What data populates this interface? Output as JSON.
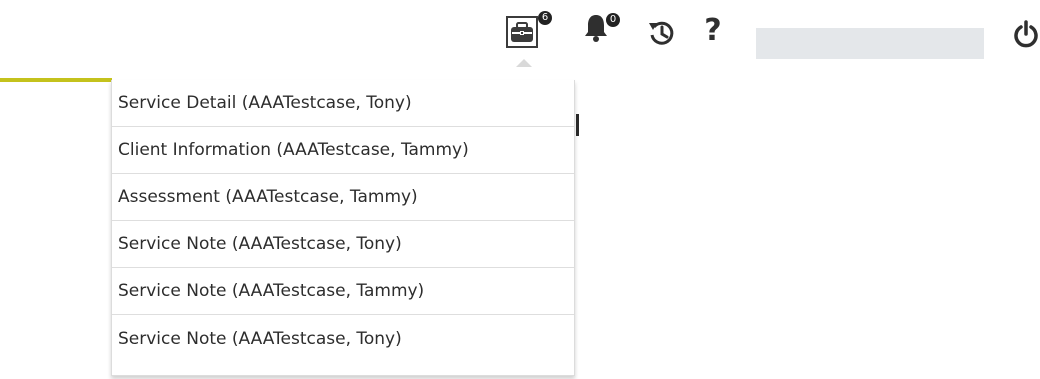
{
  "toolbar": {
    "open_documents": {
      "icon": "briefcase-icon",
      "count": "6"
    },
    "notifications": {
      "icon": "bell-icon",
      "count": "0"
    },
    "history": {
      "icon": "history-icon"
    },
    "help": {
      "icon": "help-icon",
      "label": "?"
    },
    "logout": {
      "icon": "power-icon"
    }
  },
  "colors": {
    "accent_underline": "#c4c21c",
    "icon": "#2f2f2f",
    "user_bar": "#e4e7ea"
  },
  "open_documents_menu": {
    "items": [
      {
        "label": "Service Detail (AAATestcase, Tony)"
      },
      {
        "label": "Client Information (AAATestcase, Tammy)"
      },
      {
        "label": "Assessment (AAATestcase, Tammy)"
      },
      {
        "label": "Service Note (AAATestcase, Tony)"
      },
      {
        "label": "Service Note (AAATestcase, Tammy)"
      },
      {
        "label": "Service Note (AAATestcase, Tony)"
      }
    ]
  }
}
